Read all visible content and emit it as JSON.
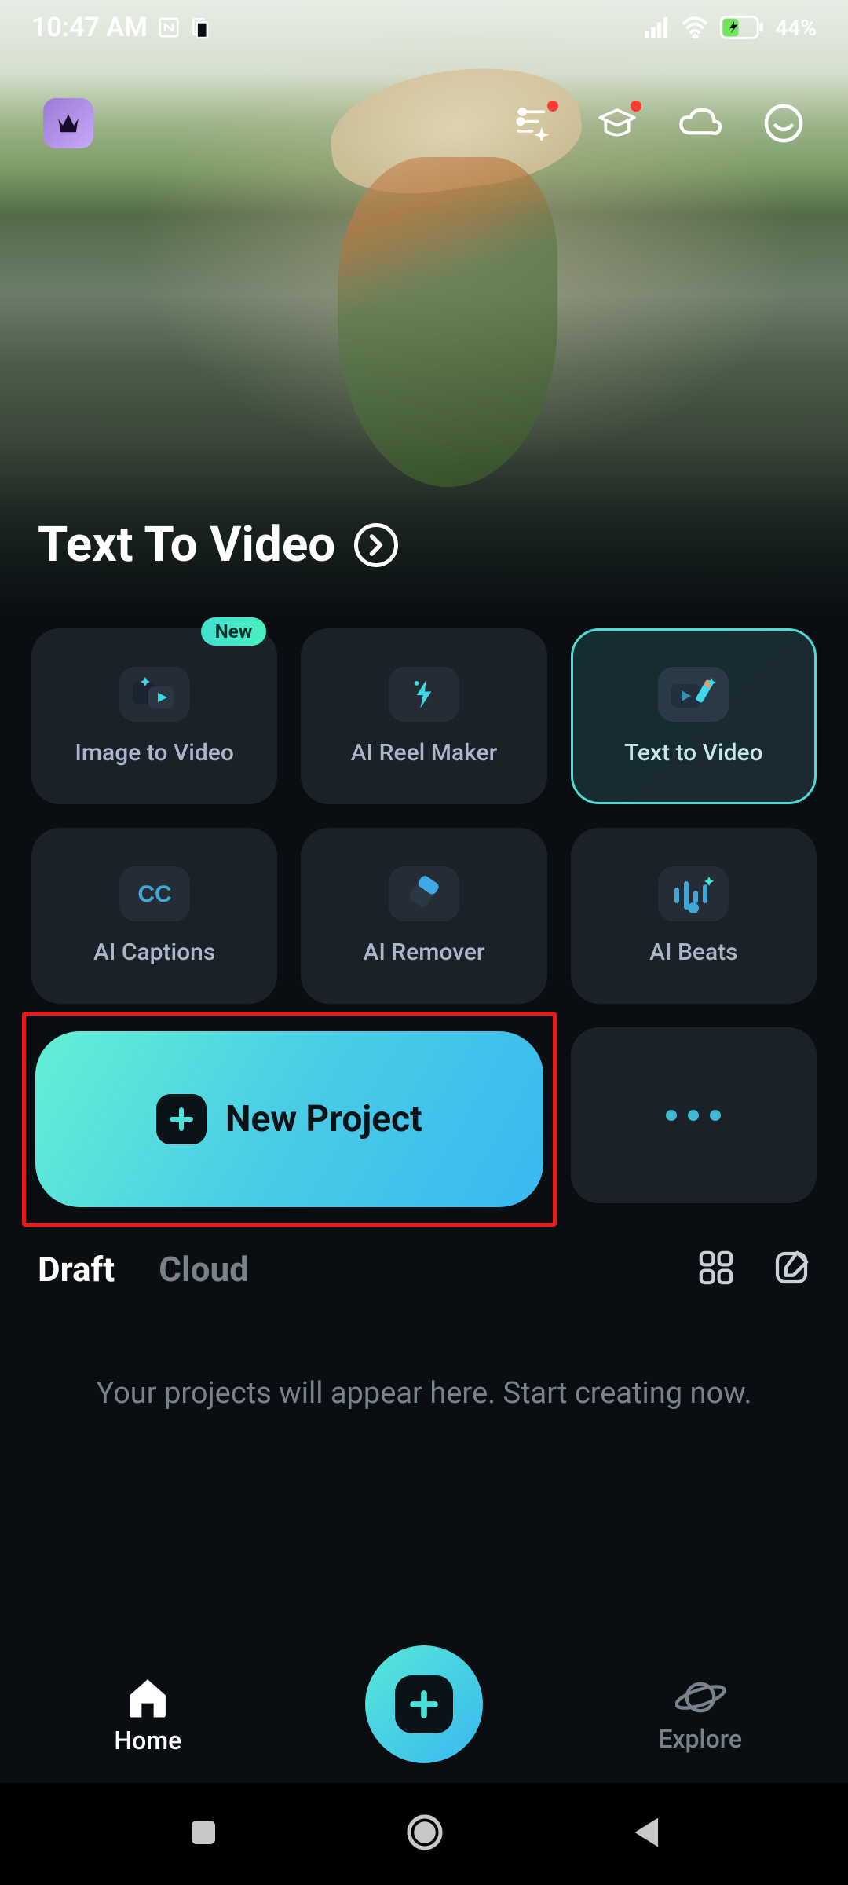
{
  "status": {
    "time": "10:47 AM",
    "battery_pct": "44%"
  },
  "hero": {
    "title": "Text To Video"
  },
  "features": [
    {
      "label": "Image to Video",
      "badge": "New",
      "selected": false
    },
    {
      "label": "AI Reel Maker",
      "selected": false
    },
    {
      "label": "Text to Video",
      "selected": true
    },
    {
      "label": "AI Captions",
      "selected": false
    },
    {
      "label": "AI Remover",
      "selected": false
    },
    {
      "label": "AI Beats",
      "selected": false
    }
  ],
  "new_project": {
    "label": "New Project"
  },
  "tabs": {
    "draft": "Draft",
    "cloud": "Cloud"
  },
  "empty_message": "Your projects will appear here. Start creating now.",
  "bottom_nav": {
    "home": "Home",
    "explore": "Explore"
  }
}
